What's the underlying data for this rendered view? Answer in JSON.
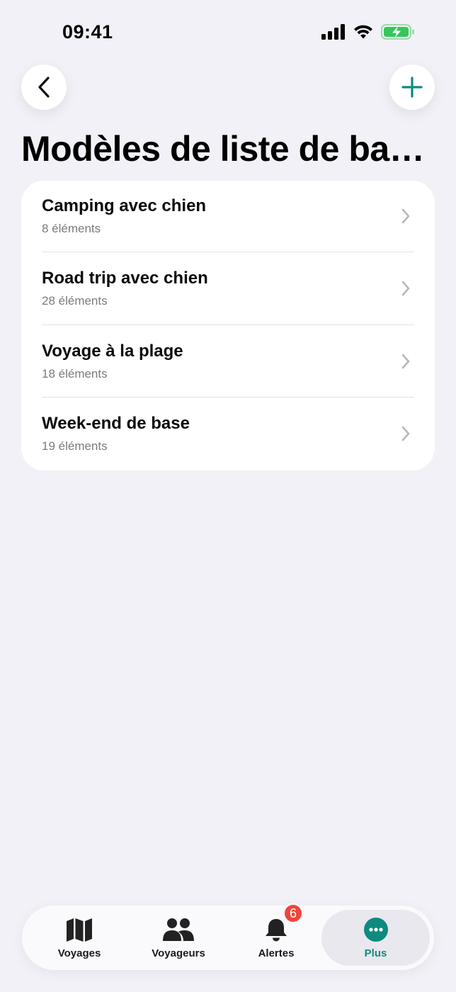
{
  "status_bar": {
    "time": "09:41",
    "icons": [
      "cellular-signal-icon",
      "wifi-icon",
      "battery-charging-icon"
    ]
  },
  "header": {
    "back_icon": "chevron-left-icon",
    "add_icon": "plus-icon",
    "title": "Modèles de liste de bagages"
  },
  "templates": [
    {
      "title": "Camping avec chien",
      "count": "8 éléments"
    },
    {
      "title": "Road trip avec chien",
      "count": "28 éléments"
    },
    {
      "title": "Voyage à la plage",
      "count": "18 éléments"
    },
    {
      "title": "Week-end de base",
      "count": "19 éléments"
    }
  ],
  "tab_bar": {
    "tabs": [
      {
        "label": "Voyages",
        "icon": "map-icon"
      },
      {
        "label": "Voyageurs",
        "icon": "people-icon"
      },
      {
        "label": "Alertes",
        "icon": "bell-icon",
        "badge": "6"
      },
      {
        "label": "Plus",
        "icon": "more-icon",
        "selected": true
      }
    ]
  },
  "colors": {
    "accent": "#0F8A80",
    "background": "#F2F1F7",
    "badge": "#F0443E",
    "battery": "#34C759"
  }
}
